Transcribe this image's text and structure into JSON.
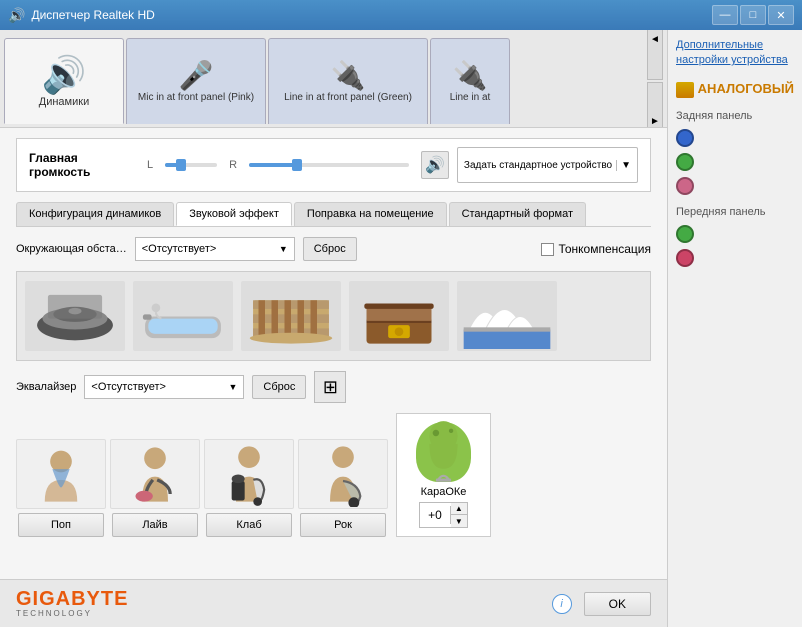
{
  "titlebar": {
    "title": "Диспетчер Realtek HD",
    "min_btn": "—",
    "max_btn": "□",
    "close_btn": "✕"
  },
  "device_tabs": [
    {
      "id": "speakers",
      "label": "Динамики",
      "icon": "🔊",
      "active": true
    },
    {
      "id": "mic-front",
      "label": "Mic in at front panel (Pink)",
      "icon": "🎤",
      "active": false
    },
    {
      "id": "line-front",
      "label": "Line in at front panel (Green)",
      "icon": "🔌",
      "active": false
    },
    {
      "id": "line-in",
      "label": "Line in at",
      "icon": "🔌",
      "active": false
    }
  ],
  "scroll_btns": {
    "left": "◄",
    "right": "►"
  },
  "volume": {
    "label": "Главная громкость",
    "l_label": "L",
    "r_label": "R",
    "fill_pct": 30,
    "thumb_pct": 30,
    "icon": "🔊",
    "set_default_label": "Задать стандартное устройство",
    "set_default_arrow": "▼"
  },
  "inner_tabs": [
    {
      "id": "config",
      "label": "Конфигурация динамиков",
      "active": false
    },
    {
      "id": "sound-effect",
      "label": "Звуковой эффект",
      "active": true
    },
    {
      "id": "room",
      "label": "Поправка на помещение",
      "active": false
    },
    {
      "id": "format",
      "label": "Стандартный формат",
      "active": false
    }
  ],
  "environment": {
    "label": "Окружающая обста…",
    "select_value": "<Отсутствует>",
    "select_arrow": "▼",
    "reset_btn": "Сброс",
    "tone_label": "Тонкомпенсация",
    "scenes": [
      {
        "id": "scene-disc",
        "emoji": "💿",
        "title": "Disc"
      },
      {
        "id": "scene-bath",
        "emoji": "🛁",
        "title": "Bath"
      },
      {
        "id": "scene-colosseum",
        "emoji": "🏟",
        "title": "Colosseum"
      },
      {
        "id": "scene-chest",
        "emoji": "📦",
        "title": "Chest"
      },
      {
        "id": "scene-opera",
        "emoji": "🏛",
        "title": "Opera"
      }
    ]
  },
  "equalizer": {
    "label": "Эквалайзер",
    "select_value": "<Отсутствует>",
    "select_arrow": "▼",
    "reset_btn": "Сброс",
    "grid_icon": "▦"
  },
  "presets": [
    {
      "id": "pop",
      "label": "Поп",
      "emoji": "🧑‍🎤"
    },
    {
      "id": "live",
      "label": "Лайв",
      "emoji": "🎸"
    },
    {
      "id": "club",
      "label": "Клаб",
      "emoji": "🎹"
    },
    {
      "id": "rock",
      "label": "Рок",
      "emoji": "🎸"
    }
  ],
  "karaoke": {
    "label": "КараОКе",
    "value": "+0",
    "up_arrow": "▲",
    "down_arrow": "▼"
  },
  "bottom": {
    "gigabyte_main": "GIGABYTE",
    "gigabyte_sub": "TECHNOLOGY",
    "info_icon": "i",
    "ok_btn": "OK"
  },
  "right_panel": {
    "link_text": "Дополнительные настройки устройства",
    "analog_label": "АНАЛОГОВЫЙ",
    "rear_panel_label": "Задняя панель",
    "rear_connectors": [
      {
        "id": "rear-blue",
        "color_class": "dot-blue"
      },
      {
        "id": "rear-green",
        "color_class": "dot-green"
      },
      {
        "id": "rear-pink",
        "color_class": "dot-pink"
      }
    ],
    "front_panel_label": "Передняя панель",
    "front_connectors": [
      {
        "id": "front-green",
        "color_class": "dot-green2"
      },
      {
        "id": "front-pink",
        "color_class": "dot-pink2"
      }
    ]
  }
}
